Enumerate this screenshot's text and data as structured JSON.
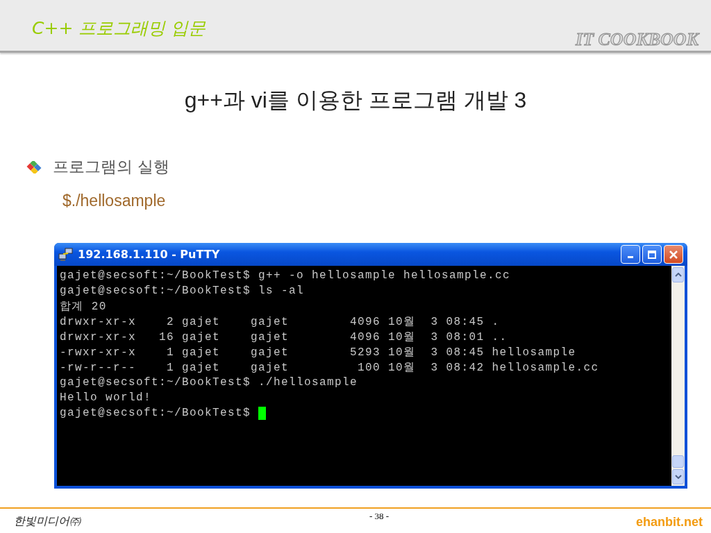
{
  "header": {
    "course": "C++ 프로그래밍 입문",
    "brand": "IT COOKBOOK"
  },
  "title": "g++과 vi를 이용한 프로그램 개발 3",
  "bullet": {
    "text": "프로그램의 실행",
    "command": "$./hellosample"
  },
  "window": {
    "title": "192.168.1.110 - PuTTY",
    "terminal": {
      "lines": [
        "gajet@secsoft:~/BookTest$ g++ -o hellosample hellosample.cc",
        "gajet@secsoft:~/BookTest$ ls -al",
        "합계 20",
        "drwxr-xr-x    2 gajet    gajet        4096 10월  3 08:45 .",
        "drwxr-xr-x   16 gajet    gajet        4096 10월  3 08:01 ..",
        "-rwxr-xr-x    1 gajet    gajet        5293 10월  3 08:45 hellosample",
        "-rw-r--r--    1 gajet    gajet         100 10월  3 08:42 hellosample.cc",
        "gajet@secsoft:~/BookTest$ ./hellosample",
        "Hello world!",
        "gajet@secsoft:~/BookTest$ "
      ],
      "cursor": true
    }
  },
  "footer": {
    "publisher": "한빛미디어㈜",
    "page": "- 38 -",
    "site": "ehanbit.net"
  }
}
